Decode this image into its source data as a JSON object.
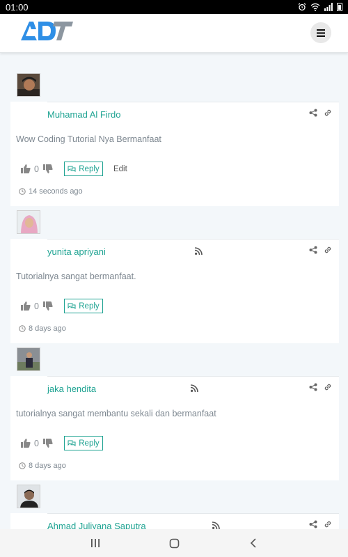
{
  "status": {
    "time": "01:00"
  },
  "comments": [
    {
      "author": "Muhamad Al Firdo",
      "text": "Wow Coding Tutorial Nya Bermanfaat",
      "votes": "0",
      "reply_label": "Reply",
      "edit_label": "Edit",
      "time": "14 seconds ago"
    },
    {
      "author": "yunita apriyani",
      "text": "Tutorialnya sangat bermanfaat.",
      "votes": "0",
      "reply_label": "Reply",
      "time": "8 days ago"
    },
    {
      "author": "jaka hendita",
      "text": "tutorialnya sangat membantu sekali dan bermanfaat",
      "votes": "0",
      "reply_label": "Reply",
      "time": "8 days ago"
    },
    {
      "author": "Ahmad Juliyana Saputra"
    }
  ],
  "colors": {
    "accent": "#1ea392",
    "logo_blue": "#2f8fe6",
    "logo_gray": "#8c96a0"
  }
}
